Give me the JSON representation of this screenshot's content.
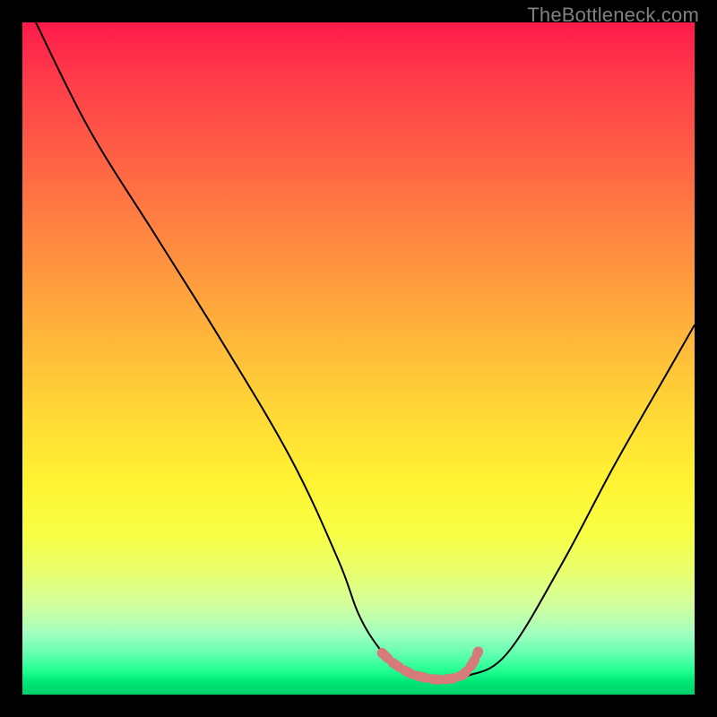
{
  "watermark": "TheBottleneck.com",
  "colors": {
    "background": "#000000",
    "curve": "#000000",
    "marker": "#d77a7a",
    "gradient_top": "#ff1a4a",
    "gradient_mid": "#fff232",
    "gradient_bottom": "#00d068"
  },
  "chart_data": {
    "type": "line",
    "title": "",
    "xlabel": "",
    "ylabel": "",
    "xlim": [
      0,
      100
    ],
    "ylim": [
      0,
      100
    ],
    "grid": false,
    "series": [
      {
        "name": "bottleneck-curve",
        "x": [
          2,
          10,
          20,
          30,
          40,
          47,
          50,
          53,
          56,
          60,
          63,
          66,
          72,
          80,
          88,
          96,
          100
        ],
        "values": [
          100,
          84,
          68,
          52,
          35,
          20,
          12,
          7,
          4,
          2.5,
          2,
          2.7,
          6,
          19,
          34,
          48,
          55
        ]
      }
    ],
    "markers": {
      "name": "highlight-band",
      "x": [
        53.5,
        55,
        56.5,
        58,
        59.5,
        61,
        62.5,
        64,
        65.5,
        66.0,
        66.7,
        67.3,
        67.8
      ],
      "values": [
        6.2,
        4.8,
        3.8,
        3.0,
        2.6,
        2.3,
        2.2,
        2.4,
        2.9,
        3.4,
        4.2,
        5.2,
        6.4
      ]
    }
  }
}
